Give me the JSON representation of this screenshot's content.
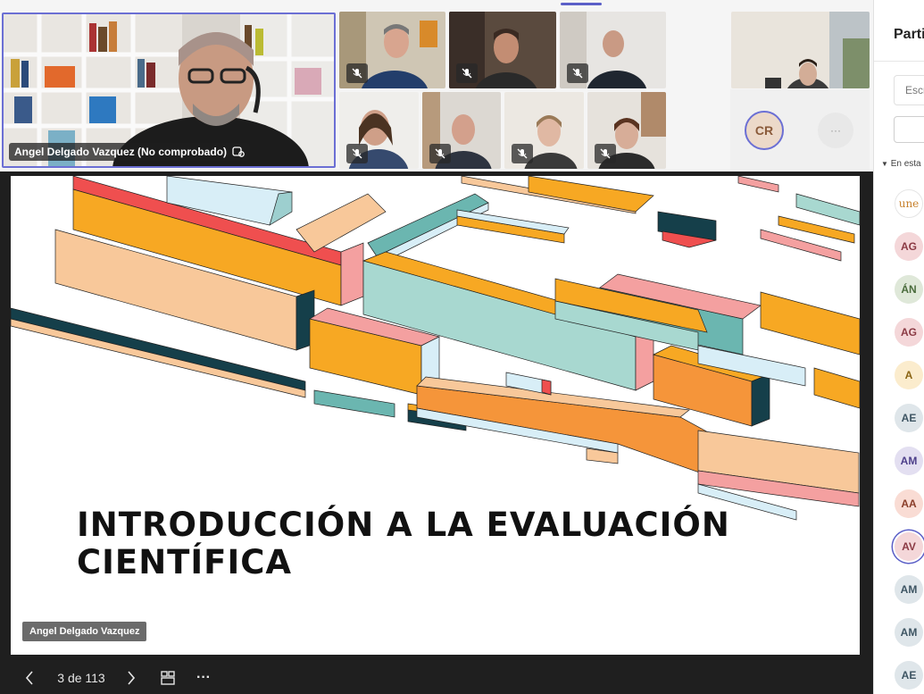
{
  "speaker": {
    "name": "Angel Delgado Vazquez (No comprobado)"
  },
  "slide": {
    "title_line1": "INTRODUCCIÓN A LA EVALUACIÓN",
    "title_line2": "CIENTÍFICA"
  },
  "presenter_label": "Angel Delgado Vazquez",
  "controls": {
    "page_indicator": "3 de 113",
    "more": "···"
  },
  "tiles": [
    {
      "id": "p1"
    },
    {
      "id": "p2"
    },
    {
      "id": "p3"
    },
    {
      "id": "p4"
    },
    {
      "id": "p5"
    },
    {
      "id": "p6"
    },
    {
      "id": "p7"
    },
    {
      "id": "p8"
    }
  ],
  "avatars": {
    "cr": "CR",
    "more": "···"
  },
  "panel": {
    "title": "Partic",
    "search_placeholder": "Escri",
    "section": "En esta",
    "participants": [
      {
        "initials": "une",
        "bg": "#ffffff",
        "fg": "#c8822e",
        "border": "#e5e5e5"
      },
      {
        "initials": "AG",
        "bg": "#f4d7d9",
        "fg": "#8b3a44"
      },
      {
        "initials": "ÁN",
        "bg": "#dfe8d9",
        "fg": "#4a6b3c"
      },
      {
        "initials": "AG",
        "bg": "#f4d7d9",
        "fg": "#8b3a44"
      },
      {
        "initials": "A",
        "bg": "#fbeccd",
        "fg": "#8a6414"
      },
      {
        "initials": "AE",
        "bg": "#dfe6ea",
        "fg": "#3e5563"
      },
      {
        "initials": "AM",
        "bg": "#e3dff1",
        "fg": "#4d3f8a"
      },
      {
        "initials": "AA",
        "bg": "#f9dcd4",
        "fg": "#8a3e2a"
      },
      {
        "initials": "AV",
        "bg": "#f4d7d9",
        "fg": "#8b3a44",
        "ring": "#5b5fc7"
      },
      {
        "initials": "AM",
        "bg": "#dfe6ea",
        "fg": "#3e5563"
      },
      {
        "initials": "AM",
        "bg": "#dfe6ea",
        "fg": "#3e5563"
      },
      {
        "initials": "AE",
        "bg": "#dfe6ea",
        "fg": "#3e5563"
      }
    ]
  },
  "colors": {
    "accent": "#5b5fc7",
    "stage": "#1f1f1f"
  }
}
